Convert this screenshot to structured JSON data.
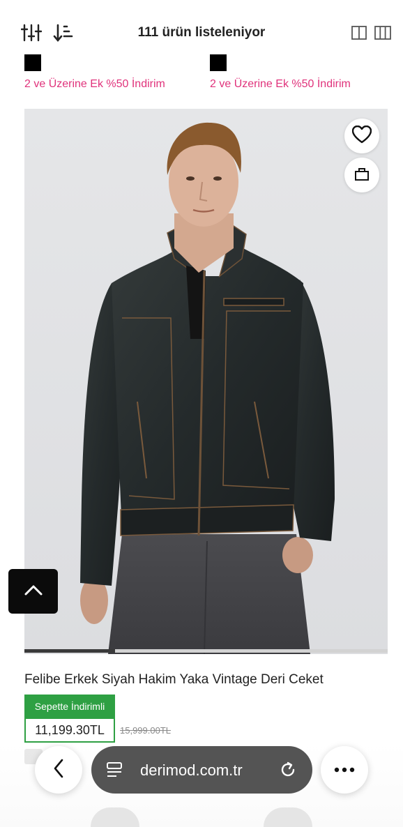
{
  "toolbar": {
    "filter_icon": "filter-sliders-icon",
    "sort_icon": "sort-icon",
    "listing_count": "111 ürün listeleniyor",
    "grid2_icon": "grid-two-column-icon",
    "grid3_icon": "grid-three-column-icon"
  },
  "previous_row": [
    {
      "swatch_color": "#000000",
      "promo": "2 ve Üzerine Ek %50 İndirim"
    },
    {
      "swatch_color": "#000000",
      "promo": "2 ve Üzerine Ek %50 İndirim"
    }
  ],
  "product": {
    "name": "Felibe Erkek Siyah Hakim Yaka Vintage Deri Ceket",
    "image_alt": "Man wearing black leather jacket",
    "favorite_icon": "heart-icon",
    "bag_icon": "shopping-bag-icon",
    "badge": "Sepette İndirimli",
    "price": "11,199.30TL",
    "old_price": "15,999.00TL",
    "image_slider_position": "1/4"
  },
  "scroll_top": {
    "icon": "chevron-up-icon"
  },
  "browser": {
    "back_icon": "chevron-left-icon",
    "site_icon": "site-settings-icon",
    "url": "derimod.com.tr",
    "reload_icon": "reload-icon",
    "more_icon": "more-dots-icon"
  },
  "colors": {
    "promo_pink": "#e0327b",
    "badge_green": "#2ea043",
    "url_bar": "#545454"
  }
}
